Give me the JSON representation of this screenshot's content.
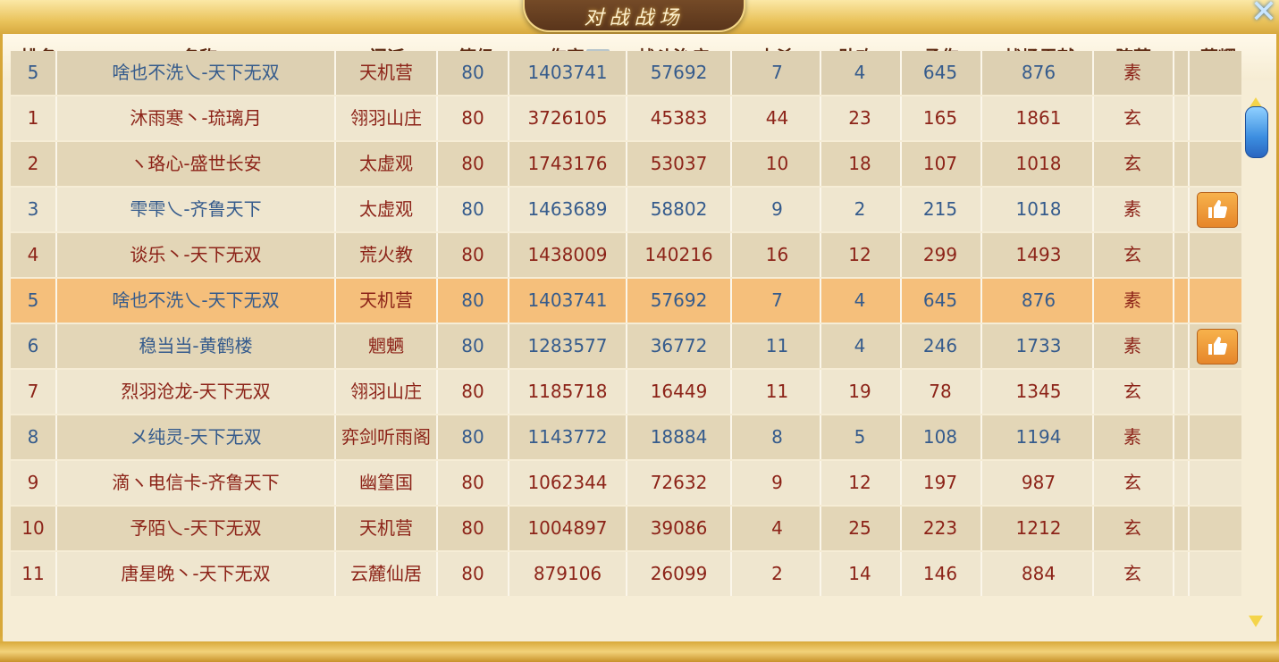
{
  "window": {
    "title": "对战战场",
    "close_icon": "close-icon"
  },
  "columns": [
    "排名",
    "名称",
    "门派",
    "等级",
    "伤害",
    "战斗治疗",
    "击杀",
    "助攻",
    "承伤",
    "战场贡献",
    "阵营",
    "荣耀"
  ],
  "sort": {
    "column": "伤害",
    "direction": "desc"
  },
  "pinned_row": {
    "rank": "5",
    "name": "啥也不洗乀-天下无双",
    "sect": "天机营",
    "level": "80",
    "damage": "1403741",
    "heal": "57692",
    "kills": "7",
    "assists": "4",
    "taken": "645",
    "contribution": "876",
    "camp": "素",
    "honor": false
  },
  "rows": [
    {
      "rank": "1",
      "name": "沐雨寒丶-琉璃月",
      "sect": "翎羽山庄",
      "level": "80",
      "damage": "3726105",
      "heal": "45383",
      "kills": "44",
      "assists": "23",
      "taken": "165",
      "contribution": "1861",
      "camp": "玄",
      "honor": false,
      "self": false
    },
    {
      "rank": "2",
      "name": "ヽ珞心-盛世长安",
      "sect": "太虚观",
      "level": "80",
      "damage": "1743176",
      "heal": "53037",
      "kills": "10",
      "assists": "18",
      "taken": "107",
      "contribution": "1018",
      "camp": "玄",
      "honor": false,
      "self": false
    },
    {
      "rank": "3",
      "name": "雫雫乀-齐鲁天下",
      "sect": "太虚观",
      "level": "80",
      "damage": "1463689",
      "heal": "58802",
      "kills": "9",
      "assists": "2",
      "taken": "215",
      "contribution": "1018",
      "camp": "素",
      "honor": true,
      "self": false
    },
    {
      "rank": "4",
      "name": "谈乐丶-天下无双",
      "sect": "荒火教",
      "level": "80",
      "damage": "1438009",
      "heal": "140216",
      "kills": "16",
      "assists": "12",
      "taken": "299",
      "contribution": "1493",
      "camp": "玄",
      "honor": false,
      "self": false
    },
    {
      "rank": "5",
      "name": "啥也不洗乀-天下无双",
      "sect": "天机营",
      "level": "80",
      "damage": "1403741",
      "heal": "57692",
      "kills": "7",
      "assists": "4",
      "taken": "645",
      "contribution": "876",
      "camp": "素",
      "honor": false,
      "self": true
    },
    {
      "rank": "6",
      "name": "稳当当-黄鹤楼",
      "sect": "魍魉",
      "level": "80",
      "damage": "1283577",
      "heal": "36772",
      "kills": "11",
      "assists": "4",
      "taken": "246",
      "contribution": "1733",
      "camp": "素",
      "honor": true,
      "self": false
    },
    {
      "rank": "7",
      "name": "烈羽沧龙-天下无双",
      "sect": "翎羽山庄",
      "level": "80",
      "damage": "1185718",
      "heal": "16449",
      "kills": "11",
      "assists": "19",
      "taken": "78",
      "contribution": "1345",
      "camp": "玄",
      "honor": false,
      "self": false
    },
    {
      "rank": "8",
      "name": "メ纯灵-天下无双",
      "sect": "弈剑听雨阁",
      "level": "80",
      "damage": "1143772",
      "heal": "18884",
      "kills": "8",
      "assists": "5",
      "taken": "108",
      "contribution": "1194",
      "camp": "素",
      "honor": false,
      "self": false
    },
    {
      "rank": "9",
      "name": "滴ヽ电信卡-齐鲁天下",
      "sect": "幽篁国",
      "level": "80",
      "damage": "1062344",
      "heal": "72632",
      "kills": "9",
      "assists": "12",
      "taken": "197",
      "contribution": "987",
      "camp": "玄",
      "honor": false,
      "self": false
    },
    {
      "rank": "10",
      "name": "予陌乀-天下无双",
      "sect": "天机营",
      "level": "80",
      "damage": "1004897",
      "heal": "39086",
      "kills": "4",
      "assists": "25",
      "taken": "223",
      "contribution": "1212",
      "camp": "玄",
      "honor": false,
      "self": false
    },
    {
      "rank": "11",
      "name": "唐星晚丶-天下无双",
      "sect": "云麓仙居",
      "level": "80",
      "damage": "879106",
      "heal": "26099",
      "kills": "2",
      "assists": "14",
      "taken": "146",
      "contribution": "884",
      "camp": "玄",
      "honor": false,
      "self": false
    }
  ],
  "colors": {
    "rank_text": "#8c2318",
    "blue_camp_text": "#355b8c",
    "self_row_bg": "#f5bf7b",
    "honor_button": "#e6862a"
  }
}
